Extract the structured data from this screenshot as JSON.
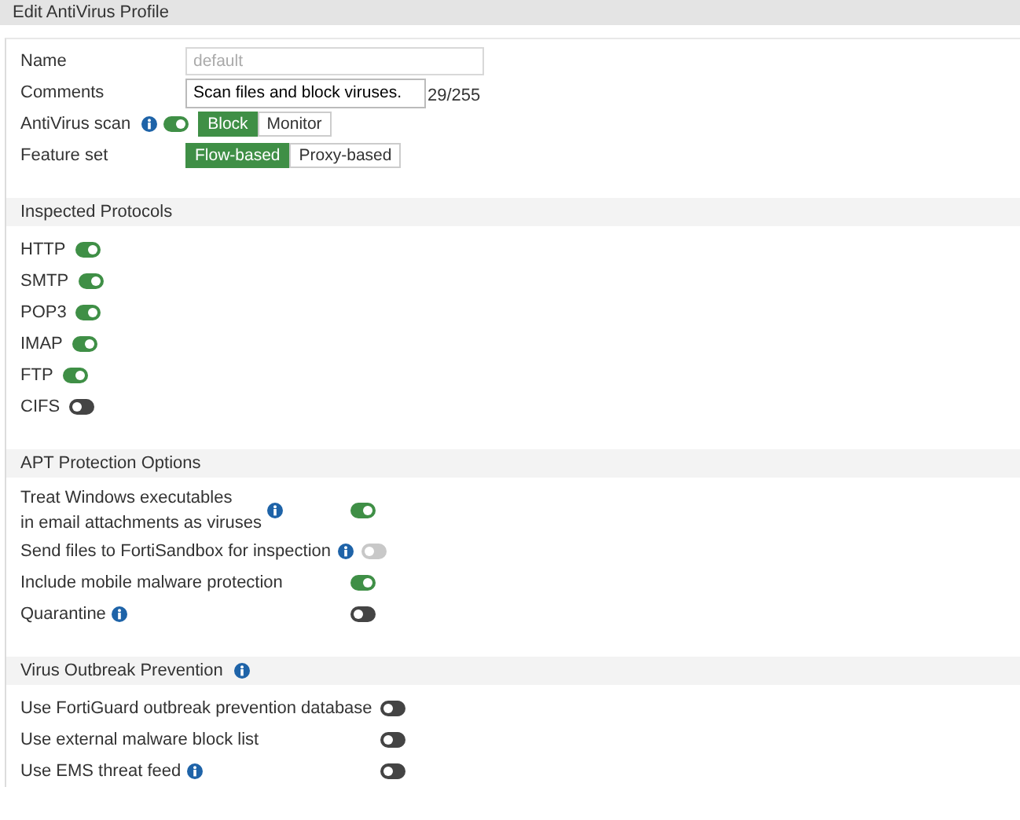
{
  "window": {
    "title": "Edit AntiVirus Profile"
  },
  "fields": [
    {
      "kind": "input",
      "label": "Name",
      "value": "default",
      "disabled": true
    },
    {
      "kind": "textarea",
      "label": "Comments",
      "value": "Scan files and block viruses.",
      "counter": "29/255"
    },
    {
      "kind": "toggle-choice",
      "label": "AntiVirus scan",
      "info": true,
      "toggle": {
        "on": true
      },
      "options": [
        {
          "label": "Block",
          "selected": true
        },
        {
          "label": "Monitor",
          "selected": false
        }
      ]
    },
    {
      "kind": "choice",
      "label": "Feature set",
      "options": [
        {
          "label": "Flow-based",
          "selected": true
        },
        {
          "label": "Proxy-based",
          "selected": false
        }
      ]
    }
  ],
  "sections": [
    {
      "title": "Inspected Protocols",
      "kind": "inline",
      "items": [
        {
          "label": "HTTP",
          "on": true
        },
        {
          "label": "SMTP",
          "on": true
        },
        {
          "label": "POP3",
          "on": true
        },
        {
          "label": "IMAP",
          "on": true
        },
        {
          "label": "FTP",
          "on": true
        },
        {
          "label": "CIFS",
          "on": false
        }
      ]
    },
    {
      "title": "APT Protection Options",
      "kind": "column",
      "items": [
        {
          "label": "Treat Windows executables\nin email attachments as viruses",
          "info": true,
          "on": true
        },
        {
          "label": "Send files to FortiSandbox for inspection",
          "info": true,
          "on": false,
          "disabled": true
        },
        {
          "label": "Include mobile malware protection",
          "on": true
        },
        {
          "label": "Quarantine",
          "info": true,
          "on": false
        }
      ]
    },
    {
      "title": "Virus Outbreak Prevention",
      "info": true,
      "kind": "column",
      "items": [
        {
          "label": "Use FortiGuard outbreak prevention database",
          "on": false
        },
        {
          "label": "Use external malware block list",
          "on": false
        },
        {
          "label": "Use EMS threat feed",
          "info": true,
          "on": false
        }
      ]
    }
  ]
}
